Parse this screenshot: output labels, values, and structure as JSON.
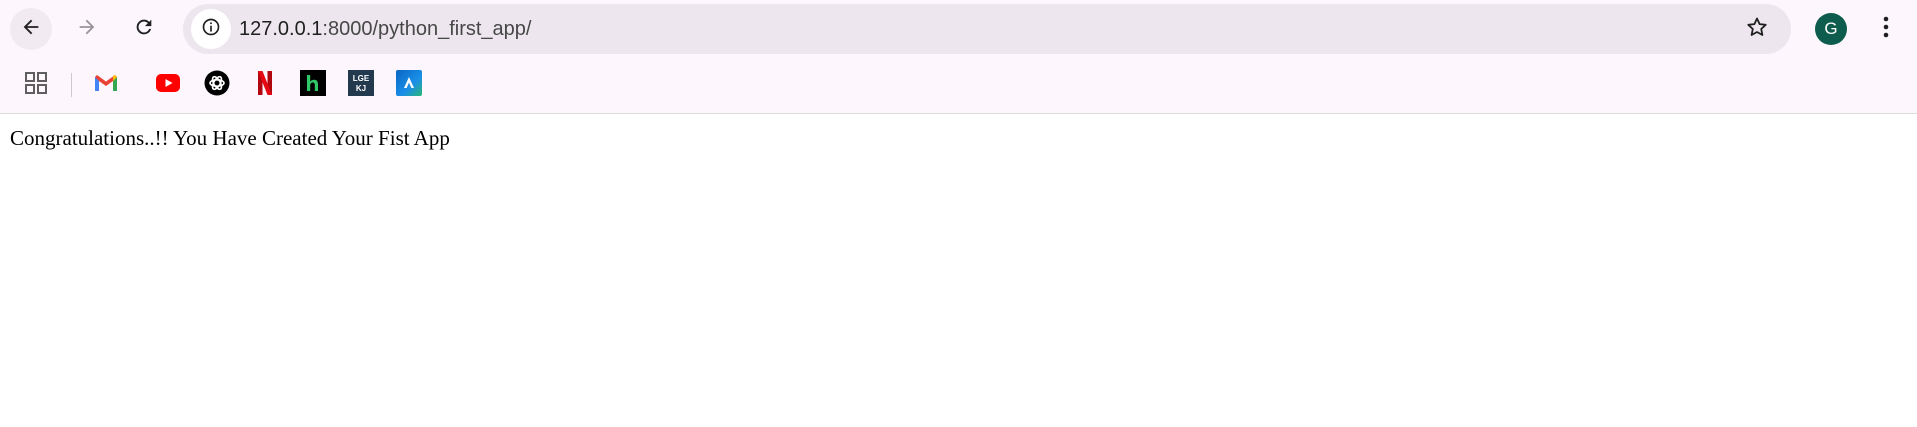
{
  "browser": {
    "url_host": "127.0.0.1",
    "url_path": ":8000/python_first_app/",
    "profile_initial": "G",
    "accent_color": "#0e5c4d",
    "icons": {
      "back": "arrow-left-icon",
      "forward": "arrow-right-icon",
      "reload": "reload-icon",
      "site_info": "info-icon",
      "bookmark_star": "star-icon",
      "menu": "three-dots-vertical-icon"
    }
  },
  "bookmarks": [
    {
      "name": "apps",
      "icon": "apps-grid-icon"
    },
    {
      "name": "gmail",
      "icon": "gmail-icon"
    },
    {
      "name": "youtube",
      "icon": "youtube-icon"
    },
    {
      "name": "chatgpt",
      "icon": "chatgpt-icon"
    },
    {
      "name": "netflix",
      "icon": "netflix-icon"
    },
    {
      "name": "hackerrank",
      "icon": "hackerrank-icon"
    },
    {
      "name": "lgekj",
      "icon": "lgekj-icon"
    },
    {
      "name": "app",
      "icon": "blue-a-icon"
    }
  ],
  "page": {
    "message": "Congratulations..!! You Have Created Your Fist App"
  }
}
